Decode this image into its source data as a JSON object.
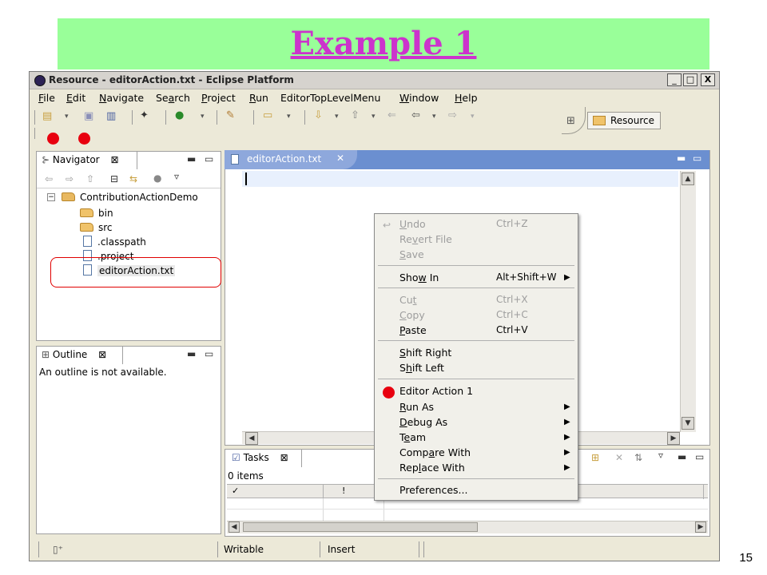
{
  "slide": {
    "title": "Example 1",
    "page_number": "15"
  },
  "window": {
    "title": "Resource - editorAction.txt - Eclipse Platform",
    "minimize": "_",
    "maximize": "□",
    "close": "X"
  },
  "menubar": [
    {
      "label": "File",
      "u": "F",
      "rest": "ile"
    },
    {
      "label": "Edit",
      "u": "E",
      "rest": "dit"
    },
    {
      "label": "Navigate",
      "u": "N",
      "rest": "avigate"
    },
    {
      "label": "Search",
      "u": "a",
      "pre": "Se",
      "rest": "rch"
    },
    {
      "label": "Project",
      "u": "P",
      "rest": "roject"
    },
    {
      "label": "Run",
      "u": "R",
      "rest": "un"
    },
    {
      "label": "EditorTopLevelMenu",
      "u": "",
      "rest": "EditorTopLevelMenu"
    },
    {
      "label": "Window",
      "u": "W",
      "rest": "indow"
    },
    {
      "label": "Help",
      "u": "H",
      "rest": "elp"
    }
  ],
  "perspective": {
    "label": "Resource"
  },
  "navigator": {
    "title": "Navigator",
    "tree": [
      {
        "label": "ContributionActionDemo",
        "kind": "project"
      },
      {
        "label": "bin",
        "kind": "folder"
      },
      {
        "label": "src",
        "kind": "folder"
      },
      {
        "label": ".classpath",
        "kind": "file"
      },
      {
        "label": ".project",
        "kind": "file"
      },
      {
        "label": "editorAction.txt",
        "kind": "file",
        "selected": true
      }
    ]
  },
  "outline": {
    "title": "Outline",
    "message": "An outline is not available."
  },
  "editor": {
    "tab_label": "editorAction.txt"
  },
  "context_menu": {
    "items": [
      {
        "label": "Undo",
        "accel": "Ctrl+Z",
        "enabled": false
      },
      {
        "label": "Revert File",
        "accel": "",
        "enabled": false
      },
      {
        "label": "Save",
        "accel": "",
        "enabled": false
      },
      {
        "label": "Show In",
        "accel": "Alt+Shift+W",
        "enabled": true,
        "submenu": true
      },
      {
        "label": "Cut",
        "accel": "Ctrl+X",
        "enabled": false
      },
      {
        "label": "Copy",
        "accel": "Ctrl+C",
        "enabled": false
      },
      {
        "label": "Paste",
        "accel": "Ctrl+V",
        "enabled": true
      },
      {
        "label": "Shift Right",
        "accel": "",
        "enabled": true
      },
      {
        "label": "Shift Left",
        "accel": "",
        "enabled": true
      },
      {
        "label": "Editor Action 1",
        "accel": "",
        "enabled": true
      },
      {
        "label": "Run As",
        "accel": "",
        "enabled": true,
        "submenu": true
      },
      {
        "label": "Debug As",
        "accel": "",
        "enabled": true,
        "submenu": true
      },
      {
        "label": "Team",
        "accel": "",
        "enabled": true,
        "submenu": true
      },
      {
        "label": "Compare With",
        "accel": "",
        "enabled": true,
        "submenu": true
      },
      {
        "label": "Replace With",
        "accel": "",
        "enabled": true,
        "submenu": true
      },
      {
        "label": "Preferences...",
        "accel": "",
        "enabled": true
      }
    ]
  },
  "tasks": {
    "title": "Tasks",
    "count": "0 items",
    "col_check": "✓",
    "col_priority": "!"
  },
  "status": {
    "writable": "Writable",
    "insert": "Insert"
  },
  "colors": {
    "title_bar_green": "#99ff99",
    "title_magenta": "#cc33cc",
    "action_red": "#e8000f",
    "editor_tab_blue": "#6b8fd0"
  }
}
